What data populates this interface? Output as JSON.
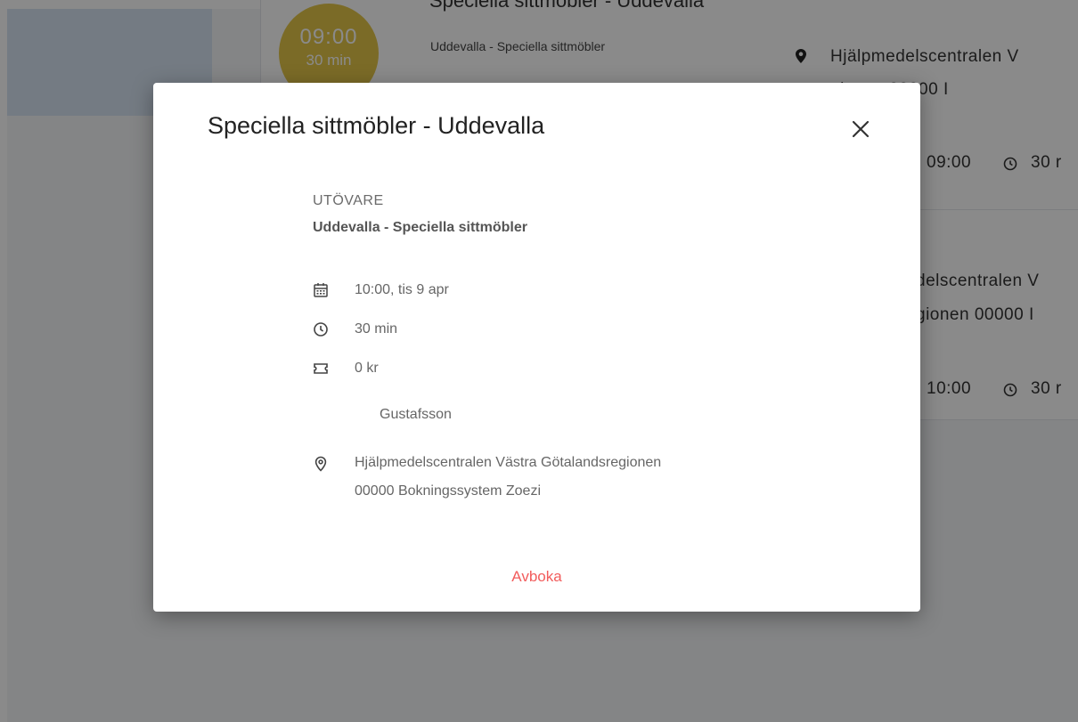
{
  "background": {
    "badge_time": "09:00",
    "badge_duration": "30 min",
    "card_title": "Speciella sittmöbler - Uddevalla",
    "card_subtitle": "Uddevalla - Speciella sittmöbler",
    "card1_location_line1": "Hjälpmedelscentralen V",
    "card1_location_line2": "gionen 00000 I",
    "card1_time": "09:00",
    "card1_duration": "30 r",
    "card2_location_line1": "delscentralen V",
    "card2_location_line2": "gionen 00000 I",
    "card2_time": "10:00",
    "card2_duration": "30 r",
    "badge_color": "#e3c649"
  },
  "dialog": {
    "title": "Speciella sittmöbler - Uddevalla",
    "performer_label": "UTÖVARE",
    "performer_name": "Uddevalla - Speciella sittmöbler",
    "date_time": "10:00, tis 9 apr",
    "duration": "30 min",
    "price": "0 kr",
    "instructor": "Gustafsson",
    "location_line1": "Hjälpmedelscentralen Västra Götalandsregionen",
    "location_line2": "00000 Bokningssystem Zoezi",
    "cancel_label": "Avboka",
    "cancel_color": "#f25c5c",
    "icons": [
      "calendar-icon",
      "clock-icon",
      "ticket-icon",
      "location-pin-icon",
      "close-icon"
    ]
  }
}
